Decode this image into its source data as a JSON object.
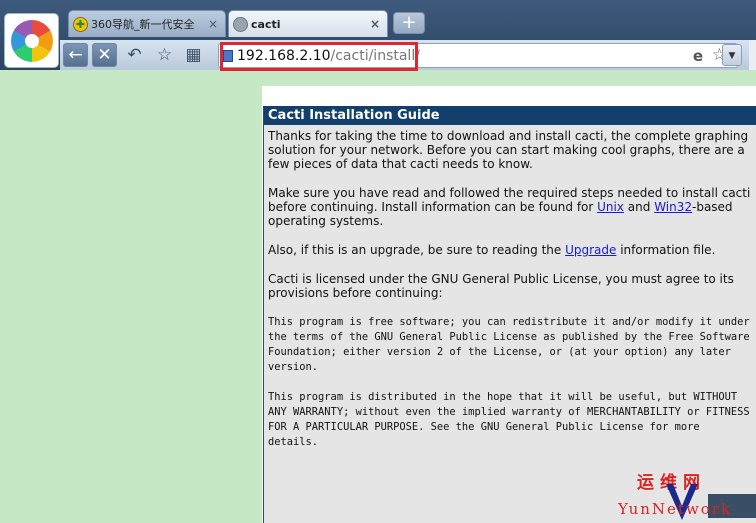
{
  "tabs": [
    {
      "title": "360导航_新一代安全",
      "close": "×"
    },
    {
      "title": "cacti",
      "close": "×"
    }
  ],
  "new_tab_label": "+",
  "favicon_inactive": "✚",
  "address": {
    "host": "192.168.2.10",
    "path": "/cacti/install/"
  },
  "address_icons": {
    "compat": "e",
    "favorite": "☆"
  },
  "nav_glyphs": {
    "back": "←",
    "stop": "✕",
    "undo": "↶",
    "star": "☆",
    "grid": "▦",
    "dropdown": "▼"
  },
  "panel": {
    "title": "Cacti Installation Guide",
    "para1": "Thanks for taking the time to download and install cacti, the complete graphing solution for your network. Before you can start making cool graphs, there are a few pieces of data that cacti needs to know.",
    "para2_pre": "Make sure you have read and followed the required steps needed to install cacti before continuing. Install information can be found for ",
    "para2_link1": "Unix",
    "para2_and": " and ",
    "para2_link2": "Win32",
    "para2_post": "-based operating systems.",
    "para3_pre": "Also, if this is an upgrade, be sure to reading the ",
    "para3_link": "Upgrade",
    "para3_post": " information file.",
    "para4": "Cacti is licensed under the GNU General Public License, you must agree to its provisions before continuing:",
    "license1": "This program is free software; you can redistribute it and/or modify it under the terms of the GNU General Public License as published by the Free Software Foundation; either version 2 of the License, or (at your option) any later version.",
    "license2": "This program is distributed in the hope that it will be useful, but WITHOUT ANY WARRANTY; without even the implied warranty of MERCHANTABILITY or FITNESS FOR A PARTICULAR PURPOSE. See the GNU General Public License for more details."
  },
  "watermark": {
    "cn": "运维网",
    "en": "YunNetwork"
  },
  "colors": {
    "page_bg": "#c6e8c4",
    "header": "#123f6b",
    "panel_bg": "#e5e5e5",
    "link": "#1a1ad0",
    "highlight": "#e0262e"
  }
}
